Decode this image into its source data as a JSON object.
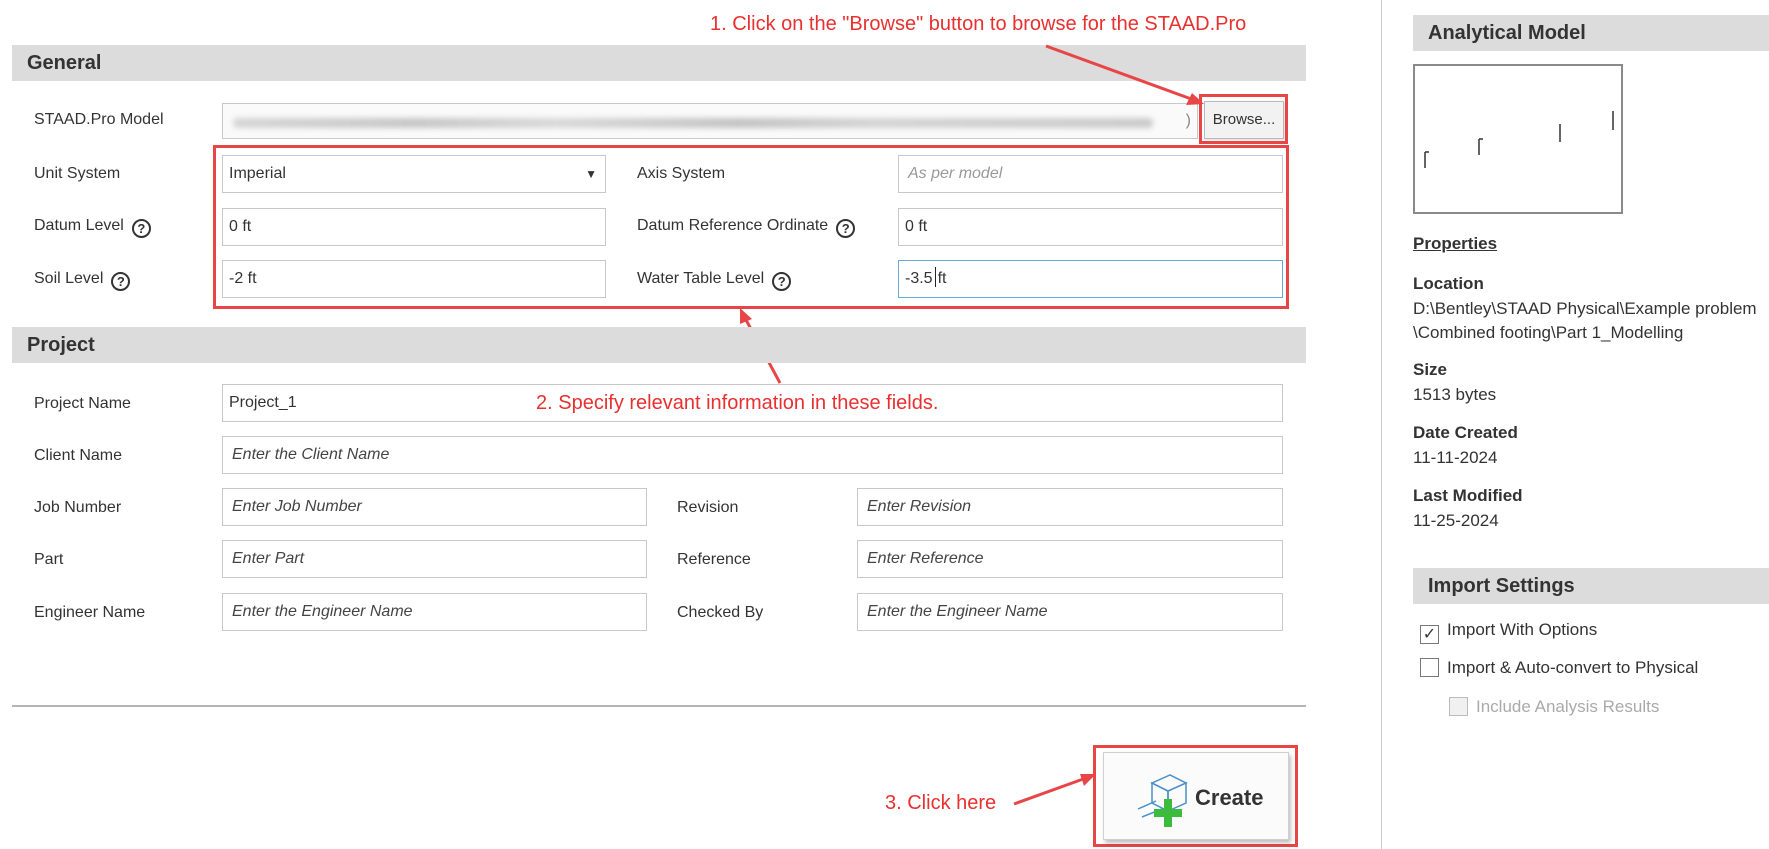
{
  "annotations": {
    "note1": "1. Click on the \"Browse\" button to browse for the STAAD.Pro",
    "note2": "2. Specify relevant information in these fields.",
    "note3": "3. Click here"
  },
  "general": {
    "title": "General",
    "staad_model_label": "STAAD.Pro Model",
    "staad_model_path_tail": ")",
    "browse_label": "Browse...",
    "unit_system_label": "Unit System",
    "unit_system_value": "Imperial",
    "axis_system_label": "Axis System",
    "axis_system_placeholder": "As per model",
    "datum_level_label": "Datum Level",
    "datum_level_value": "0 ft",
    "datum_ref_label": "Datum Reference Ordinate",
    "datum_ref_value": "0 ft",
    "soil_level_label": "Soil Level",
    "soil_level_value": "-2 ft",
    "water_table_label": "Water Table Level",
    "water_table_value_before": "-3.5",
    "water_table_value_after": "ft",
    "help_glyph": "?"
  },
  "project": {
    "title": "Project",
    "project_name_label": "Project Name",
    "project_name_value": "Project_1",
    "client_name_label": "Client Name",
    "client_name_placeholder": "Enter the Client Name",
    "job_number_label": "Job Number",
    "job_number_placeholder": "Enter Job Number",
    "revision_label": "Revision",
    "revision_placeholder": "Enter Revision",
    "part_label": "Part",
    "part_placeholder": "Enter Part",
    "reference_label": "Reference",
    "reference_placeholder": "Enter Reference",
    "engineer_name_label": "Engineer Name",
    "engineer_name_placeholder": "Enter the Engineer Name",
    "checked_by_label": "Checked By",
    "checked_by_placeholder": "Enter the Engineer Name"
  },
  "create_label": "Create",
  "analytical_model": {
    "title": "Analytical Model",
    "properties_link": "Properties",
    "location_label": "Location",
    "location_line1": "D:\\Bentley\\STAAD Physical\\Example problem",
    "location_line2": "\\Combined footing\\Part 1_Modelling",
    "size_label": "Size",
    "size_value": "1513 bytes",
    "date_created_label": "Date Created",
    "date_created_value": "11-11-2024",
    "last_modified_label": "Last Modified",
    "last_modified_value": "11-25-2024"
  },
  "import_settings": {
    "title": "Import Settings",
    "import_with_options": "Import With Options",
    "import_with_options_checked": true,
    "import_auto_convert": "Import & Auto-convert to Physical",
    "import_auto_convert_checked": false,
    "include_analysis_results": "Include Analysis Results",
    "include_analysis_results_checked": false
  },
  "colors": {
    "annotation_red": "#e84646",
    "header_gray": "#dcdcdc",
    "plus_green": "#3dbb3d",
    "active_border": "#66aadd"
  }
}
